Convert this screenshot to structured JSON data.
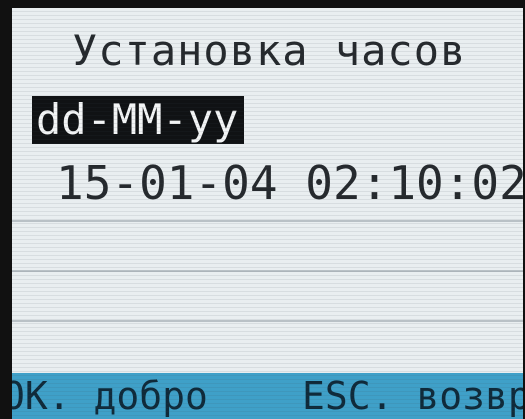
{
  "screen": {
    "title": "Установка часов",
    "date_format": "dd-MM-yy",
    "datetime_value": "15-01-04 02:10:02"
  },
  "softkeys": {
    "ok_label": "OK. добро",
    "esc_label": "ESC. возвр"
  },
  "colors": {
    "lcd_background": "#e9eef0",
    "highlight_background": "#101214",
    "softkey_bar": "#3fa0c8"
  }
}
